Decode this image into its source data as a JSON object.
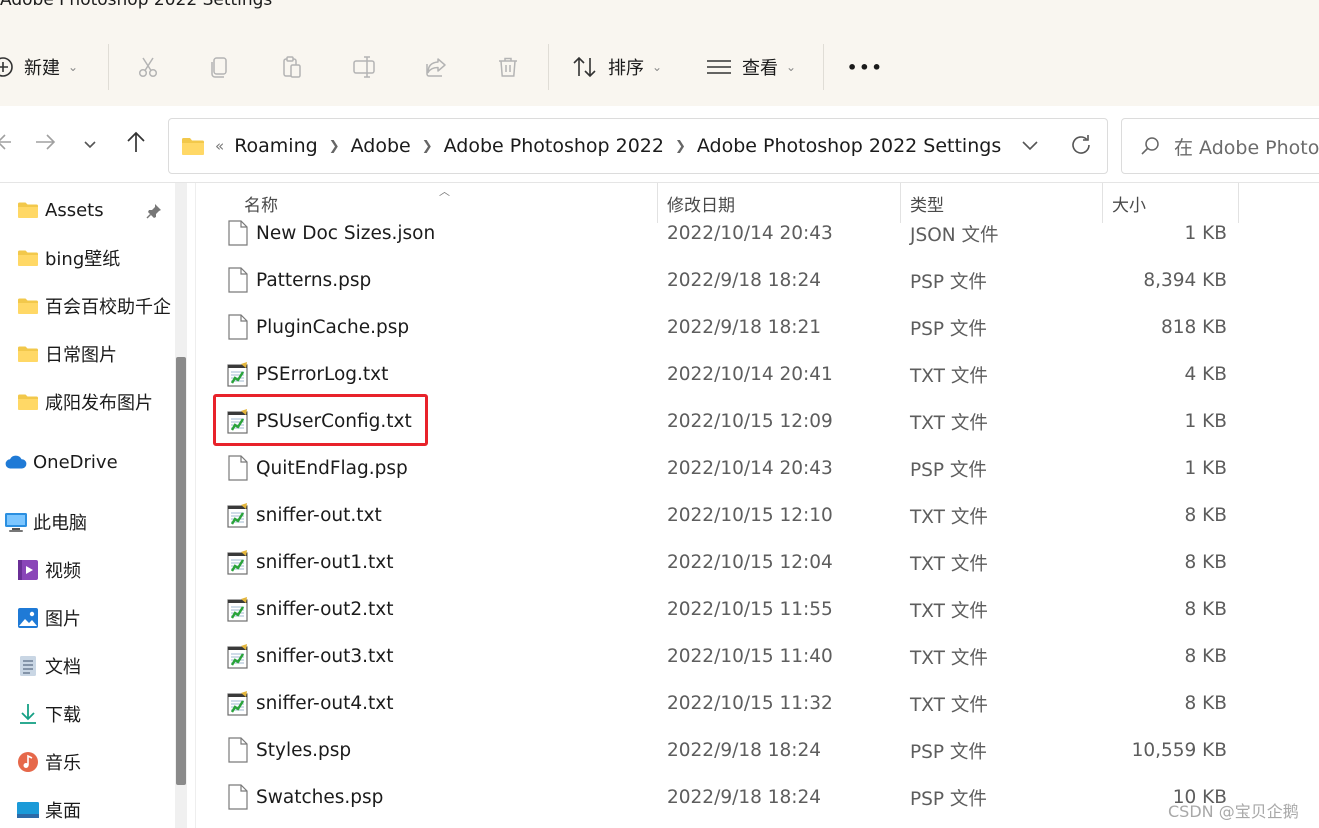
{
  "window": {
    "title": "Adobe Photoshop 2022 Settings"
  },
  "toolbar": {
    "new_label": "新建",
    "sort_label": "排序",
    "view_label": "查看",
    "more_label": "•••"
  },
  "address_bar": {
    "overflow": "«",
    "breadcrumbs": [
      "Roaming",
      "Adobe",
      "Adobe Photoshop 2022",
      "Adobe Photoshop 2022 Settings"
    ]
  },
  "search": {
    "placeholder": "在 Adobe Photo"
  },
  "sidebar": {
    "items": [
      {
        "label": "Assets",
        "icon": "folder-icon",
        "pinned": true
      },
      {
        "label": "bing壁纸",
        "icon": "folder-icon"
      },
      {
        "label": "百会百校助千企",
        "icon": "folder-icon"
      },
      {
        "label": "日常图片",
        "icon": "folder-icon"
      },
      {
        "label": "咸阳发布图片",
        "icon": "folder-icon"
      },
      {
        "label": "OneDrive",
        "icon": "cloud-icon"
      },
      {
        "label": "此电脑",
        "icon": "computer-icon"
      },
      {
        "label": "视频",
        "icon": "video-icon"
      },
      {
        "label": "图片",
        "icon": "pictures-icon"
      },
      {
        "label": "文档",
        "icon": "documents-icon"
      },
      {
        "label": "下载",
        "icon": "download-icon"
      },
      {
        "label": "音乐",
        "icon": "music-icon"
      },
      {
        "label": "桌面",
        "icon": "desktop-icon"
      }
    ]
  },
  "columns": {
    "name": "名称",
    "date": "修改日期",
    "type": "类型",
    "size": "大小"
  },
  "files": [
    {
      "name": "New Doc Sizes.json",
      "date": "2022/10/14 20:43",
      "type": "JSON 文件",
      "size": "1 KB",
      "icon": "file-icon"
    },
    {
      "name": "Patterns.psp",
      "date": "2022/9/18 18:24",
      "type": "PSP 文件",
      "size": "8,394 KB",
      "icon": "file-icon"
    },
    {
      "name": "PluginCache.psp",
      "date": "2022/9/18 18:21",
      "type": "PSP 文件",
      "size": "818 KB",
      "icon": "file-icon"
    },
    {
      "name": "PSErrorLog.txt",
      "date": "2022/10/14 20:41",
      "type": "TXT 文件",
      "size": "4 KB",
      "icon": "text-file-icon"
    },
    {
      "name": "PSUserConfig.txt",
      "date": "2022/10/15 12:09",
      "type": "TXT 文件",
      "size": "1 KB",
      "icon": "text-file-icon",
      "highlighted": true
    },
    {
      "name": "QuitEndFlag.psp",
      "date": "2022/10/14 20:43",
      "type": "PSP 文件",
      "size": "1 KB",
      "icon": "file-icon"
    },
    {
      "name": "sniffer-out.txt",
      "date": "2022/10/15 12:10",
      "type": "TXT 文件",
      "size": "8 KB",
      "icon": "text-file-icon"
    },
    {
      "name": "sniffer-out1.txt",
      "date": "2022/10/15 12:04",
      "type": "TXT 文件",
      "size": "8 KB",
      "icon": "text-file-icon"
    },
    {
      "name": "sniffer-out2.txt",
      "date": "2022/10/15 11:55",
      "type": "TXT 文件",
      "size": "8 KB",
      "icon": "text-file-icon"
    },
    {
      "name": "sniffer-out3.txt",
      "date": "2022/10/15 11:40",
      "type": "TXT 文件",
      "size": "8 KB",
      "icon": "text-file-icon"
    },
    {
      "name": "sniffer-out4.txt",
      "date": "2022/10/15 11:32",
      "type": "TXT 文件",
      "size": "8 KB",
      "icon": "text-file-icon"
    },
    {
      "name": "Styles.psp",
      "date": "2022/9/18 18:24",
      "type": "PSP 文件",
      "size": "10,559 KB",
      "icon": "file-icon"
    },
    {
      "name": "Swatches.psp",
      "date": "2022/9/18 18:24",
      "type": "PSP 文件",
      "size": "10 KB",
      "icon": "file-icon"
    }
  ],
  "watermark": "CSDN @宝贝企鹅",
  "colors": {
    "highlight": "#e8222a",
    "folder": "#f2c84b",
    "toolbar_bg": "#f9f6f0"
  }
}
